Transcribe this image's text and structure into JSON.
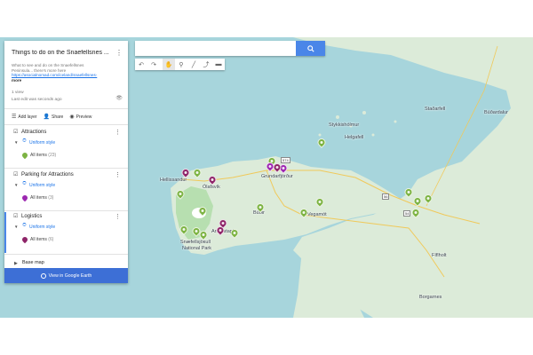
{
  "search": {
    "placeholder": "",
    "value": ""
  },
  "toolbar": {
    "tools": [
      "undo-icon",
      "redo-icon",
      "hand-icon",
      "marker-icon",
      "line-icon",
      "route-icon",
      "ruler-icon"
    ]
  },
  "panel": {
    "title": "Things to do on the Snaefellsnes ...",
    "description_line1": "What to see and do on the Snaefellsnes",
    "description_line2": "Peninsula... there's more here",
    "description_link": "https://asocialnomad.com/iceland/snaefellsnes-",
    "description_more": "more",
    "views": "1 view",
    "last_edit": "Last edit was seconds ago",
    "actions": {
      "add_layer": "Add layer",
      "share": "Share",
      "preview": "Preview"
    }
  },
  "layers": [
    {
      "name": "Attractions",
      "style": "Uniform style",
      "items_label": "All items",
      "count": "(23)",
      "color": "#7cb342"
    },
    {
      "name": "Parking for Attractions",
      "style": "Uniform style",
      "items_label": "All items",
      "count": "(3)",
      "color": "#9c27b0"
    },
    {
      "name": "Logistics",
      "style": "Uniform style",
      "items_label": "All items",
      "count": "(6)",
      "color": "#8e2468"
    }
  ],
  "basemap": {
    "label": "Base map"
  },
  "earth_button": {
    "label": "View in Google Earth"
  },
  "map": {
    "places": {
      "stadarfell": "Staðarfell",
      "budardalur": "Búðardalur",
      "stykkisholmur": "Stykkishólmur",
      "helgafell": "Helgafell",
      "hellissandur": "Hellissandur",
      "olafsvik": "Ólafsvík",
      "grundarfjordur": "Grundarfjörður",
      "budir": "Búðir",
      "arnarstapi": "Arnarstapi",
      "snaefellsjokull": "Snæfellsjökull",
      "national_park": "National Park",
      "vegamot": "Vegamót",
      "fiftinull": "Fíflholt",
      "borgarnes": "Borgarnes",
      "road_574": "574",
      "road_54": "54",
      "road_56": "56"
    },
    "colors": {
      "water": "#a7d5dc",
      "land": "#dcebd9",
      "park": "#b7dfb0",
      "attraction": "#7cb342",
      "parking": "#9c27b0",
      "logistics": "#8e2468"
    }
  }
}
